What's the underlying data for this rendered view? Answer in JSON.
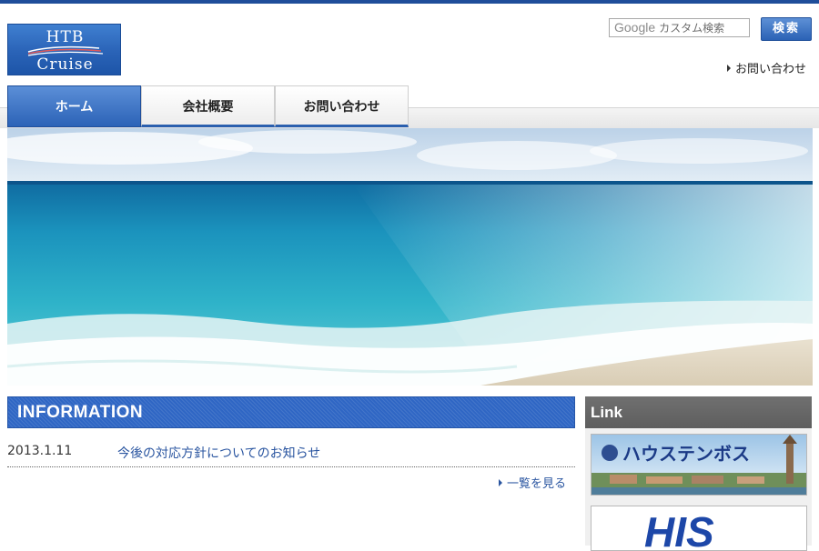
{
  "logo": {
    "line1": "HTB",
    "line2": "Cruise"
  },
  "search": {
    "provider": "Google",
    "placeholder": "カスタム検索",
    "button_label": "検索"
  },
  "header": {
    "contact_link": "お問い合わせ"
  },
  "nav": {
    "tabs": [
      {
        "label": "ホーム",
        "active": true
      },
      {
        "label": "会社概要",
        "active": false
      },
      {
        "label": "お問い合わせ",
        "active": false
      }
    ]
  },
  "information": {
    "heading": "INFORMATION",
    "items": [
      {
        "date": "2013.1.11",
        "title": "今後の対応方針についてのお知らせ"
      }
    ],
    "more_link": "一覧を見る"
  },
  "sidebar": {
    "heading": "Link",
    "banners": [
      {
        "text": "ハウステンボス"
      },
      {
        "text": "HIS"
      }
    ]
  },
  "colors": {
    "brand_blue": "#2c63b7",
    "link_blue": "#2a55a0",
    "sidebar_header": "#666666"
  },
  "icons": [
    "triangle-right-icon"
  ]
}
